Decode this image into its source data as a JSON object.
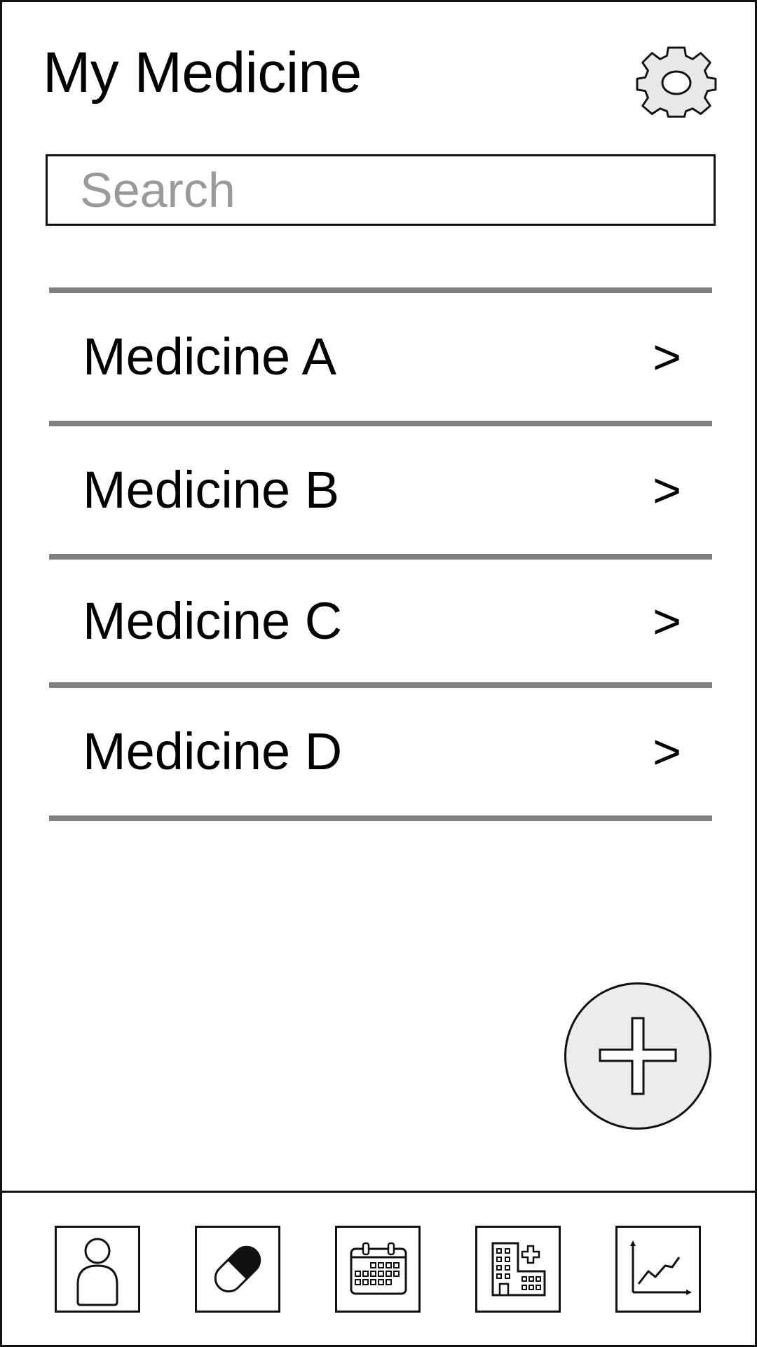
{
  "header": {
    "title": "My Medicine",
    "settings_icon": "gear-icon"
  },
  "search": {
    "placeholder": "Search",
    "value": ""
  },
  "medicines": [
    {
      "name": "Medicine A",
      "chevron": ">"
    },
    {
      "name": "Medicine B",
      "chevron": ">"
    },
    {
      "name": "Medicine C",
      "chevron": ">"
    },
    {
      "name": "Medicine D",
      "chevron": ">"
    }
  ],
  "fab": {
    "icon": "plus-icon"
  },
  "bottom_nav": [
    {
      "icon": "person-icon"
    },
    {
      "icon": "pill-icon"
    },
    {
      "icon": "calendar-icon"
    },
    {
      "icon": "hospital-icon"
    },
    {
      "icon": "chart-icon"
    }
  ],
  "colors": {
    "divider": "#808080",
    "fab_fill": "#ececec",
    "gear_fill": "#e8e8e8",
    "placeholder": "#9a9a9a"
  }
}
